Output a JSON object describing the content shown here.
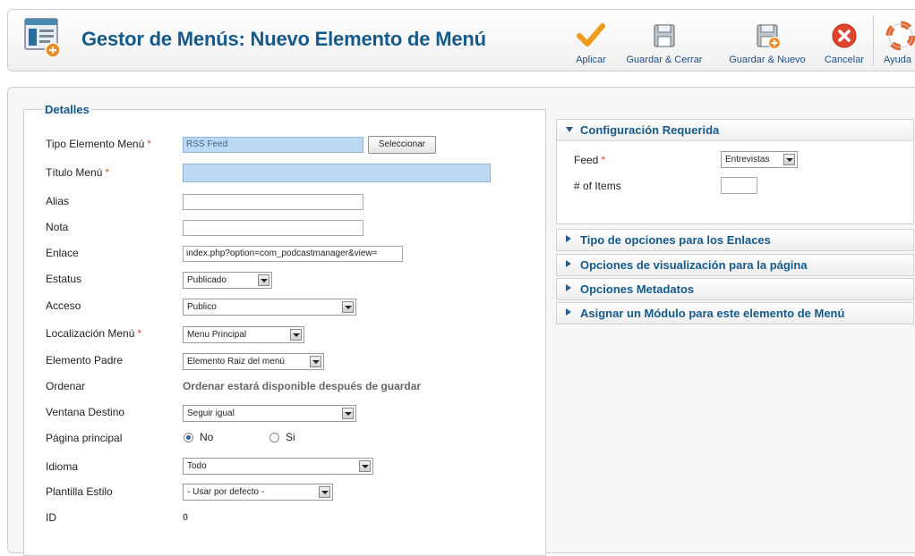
{
  "page": {
    "title": "Gestor de Menús: Nuevo Elemento de Menú"
  },
  "toolbar": {
    "buttons": [
      {
        "label": "Aplicar",
        "icon": "check-icon"
      },
      {
        "label": "Guardar & Cerrar",
        "icon": "save-icon"
      },
      {
        "label": "Guardar & Nuevo",
        "icon": "save-new-icon"
      },
      {
        "label": "Cancelar",
        "icon": "cancel-icon"
      },
      {
        "label": "Ayuda",
        "icon": "help-icon"
      }
    ]
  },
  "details": {
    "legend": "Detalles",
    "required_marker": "*",
    "fields": {
      "tipo_elemento": {
        "label": "Tipo Elemento Menú",
        "value": "RSS Feed",
        "button": "Seleccionar"
      },
      "titulo": {
        "label": "Título Menú",
        "value": ""
      },
      "alias": {
        "label": "Alias",
        "value": ""
      },
      "nota": {
        "label": "Nota",
        "value": ""
      },
      "enlace": {
        "label": "Enlace",
        "value": "index.php?option=com_podcastmanager&view="
      },
      "estatus": {
        "label": "Estatus",
        "value": "Publicado"
      },
      "acceso": {
        "label": "Acceso",
        "value": "Publico"
      },
      "localizacion": {
        "label": "Localización Menú",
        "value": "Menu Principal"
      },
      "elemento_padre": {
        "label": "Elemento Padre",
        "value": "Elemento Raiz del menú"
      },
      "ordenar": {
        "label": "Ordenar",
        "value": "Ordenar estará disponible después de guardar"
      },
      "ventana_destino": {
        "label": "Ventana Destino",
        "value": "Seguir igual"
      },
      "pagina_principal": {
        "label": "Página principal",
        "options": [
          "No",
          "Si"
        ],
        "selected": "No"
      },
      "idioma": {
        "label": "Idioma",
        "value": "Todo"
      },
      "plantilla": {
        "label": "Plantilla Estilo",
        "value": "- Usar por defecto -"
      },
      "id": {
        "label": "ID",
        "value": "0"
      }
    }
  },
  "config": {
    "title": "Configuración Requerida",
    "feed": {
      "label": "Feed",
      "value": "Entrevistas"
    },
    "items": {
      "label": "# of Items",
      "value": ""
    }
  },
  "panels": [
    {
      "title": "Tipo de opciones para los Enlaces"
    },
    {
      "title": "Opciones de visualización para la página"
    },
    {
      "title": "Opciones Metadatos"
    },
    {
      "title": "Asignar un Módulo para este elemento de Menú"
    }
  ],
  "colors": {
    "accent": "#155a8a",
    "required": "#e24b3a",
    "highlight_field": "#bcd8f3"
  }
}
